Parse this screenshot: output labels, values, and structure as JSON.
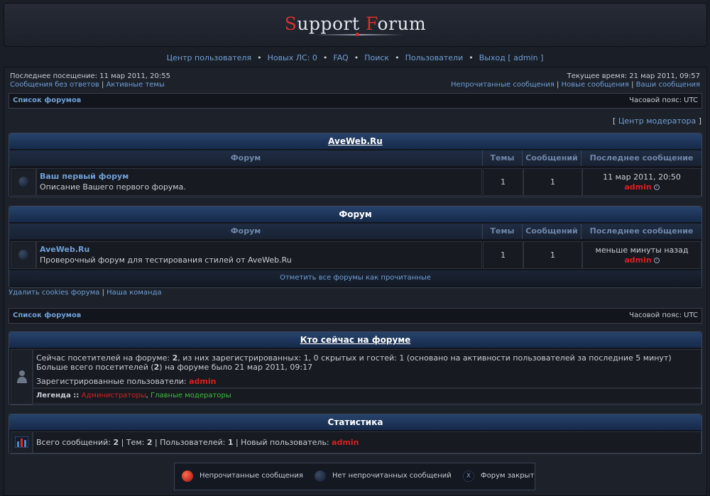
{
  "header": {
    "logo_s": "S",
    "logo_upport": "upport ",
    "logo_f": "F",
    "logo_orum": "orum"
  },
  "nav": {
    "items": [
      "Центр пользователя",
      "Новых ЛС: 0",
      "FAQ",
      "Поиск",
      "Пользователи",
      "Выход [ admin ]"
    ],
    "separator": "•"
  },
  "info": {
    "last_visit": "Последнее посещение: 11 мар 2011, 20:55",
    "unanswered": "Сообщения без ответов",
    "active": "Активные темы",
    "pipe": "|",
    "current_time": "Текущее время: 21 мар 2011, 09:57",
    "unread": "Непрочитанные сообщения",
    "new_posts": "Новые сообщения",
    "your_posts": "Ваши сообщения"
  },
  "breadcrumb": {
    "forum_list": "Список форумов",
    "timezone": "Часовой пояс: UTC"
  },
  "moderator": "Центр модератора",
  "columns": {
    "forum": "Форум",
    "topics": "Темы",
    "posts": "Сообщений",
    "last_post": "Последнее сообщение"
  },
  "category1": {
    "title": "AveWeb.Ru",
    "forum": {
      "name": "Ваш первый форум",
      "desc": "Описание Вашего первого форума.",
      "topics": "1",
      "posts": "1",
      "last_time": "11 мар 2011, 20:50",
      "last_user": "admin"
    }
  },
  "category2": {
    "title": "Форум",
    "forum": {
      "name": "AveWeb.Ru",
      "desc": "Проверочный форум для тестирования стилей от AveWeb.Ru",
      "topics": "1",
      "posts": "1",
      "last_time": "меньше минуты назад",
      "last_user": "admin"
    },
    "mark_read": "Отметить все форумы как прочитанные"
  },
  "footer_links": {
    "delete_cookies": "Удалить cookies форума",
    "team": "Наша команда"
  },
  "online": {
    "title": "Кто сейчас на форуме",
    "line1_a": "Сейчас посетителей на форуме: ",
    "line1_b": "2",
    "line1_c": ", из них зарегистрированных: 1, 0 скрытых и гостей: 1 (основано на активности пользователей за последние 5 минут)",
    "line2_a": "Больше всего посетителей (",
    "line2_b": "2",
    "line2_c": ") на форуме было 21 мар 2011, 09:17",
    "registered_label": "Зарегистрированные пользователи: ",
    "registered_user": "admin",
    "legend_label": "Легенда :: ",
    "legend_admins": "Администраторы",
    "legend_comma": ", ",
    "legend_mods": "Главные модераторы"
  },
  "stats": {
    "title": "Статистика",
    "t1": "Всего сообщений: ",
    "v1": "2",
    "t2": " | Тем: ",
    "v2": "2",
    "t3": " | Пользователей: ",
    "v3": "1",
    "t4": " | Новый пользователь: ",
    "new_user": "admin"
  },
  "legend": {
    "unread": "Непрочитанные сообщения",
    "no_unread": "Нет непрочитанных сообщений",
    "locked": "Форум закрыт",
    "locked_symbol": "X"
  },
  "colors": {
    "accent_red": "#d8201f",
    "link": "#6f9fd8",
    "header_blue": "#27426b",
    "moderator_green": "#3bbf3b"
  }
}
